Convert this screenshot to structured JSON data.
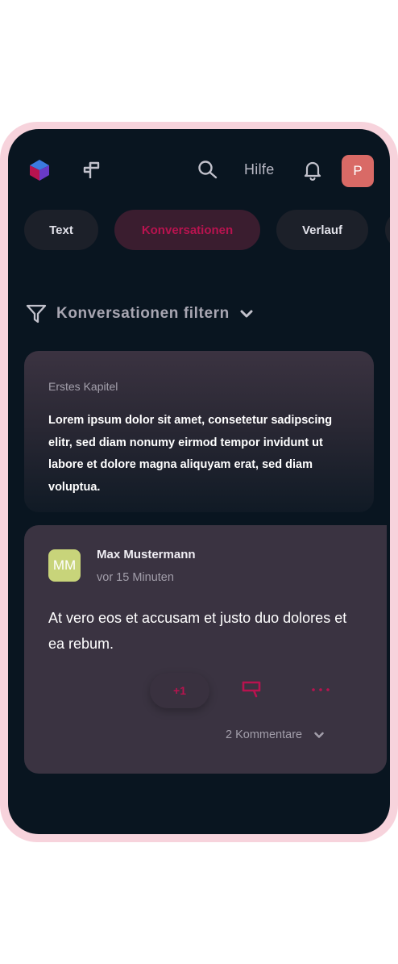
{
  "header": {
    "help_label": "Hilfe",
    "user_initial": "P",
    "icons": [
      "app-logo-icon",
      "signpost-icon",
      "search-icon",
      "bell-icon"
    ]
  },
  "tabs": [
    {
      "label": "Text",
      "active": false
    },
    {
      "label": "Konversationen",
      "active": true
    },
    {
      "label": "Verlauf",
      "active": false
    }
  ],
  "filter": {
    "label": "Konversationen filtern"
  },
  "chapter": {
    "title": "Erstes Kapitel",
    "text": "Lorem ipsum dolor sit amet, consetetur sadipscing elitr, sed diam nonumy eirmod tempor invidunt ut labore et dolore magna aliquyam erat, sed diam voluptua."
  },
  "comment": {
    "author_initials": "MM",
    "author_name": "Max Mustermann",
    "time": "vor 15 Minuten",
    "text": "At vero eos et accusam et justo duo dolores et ea rebum.",
    "upvote_label": "+1",
    "comments_count_label": "2 Kommentare"
  },
  "colors": {
    "background": "#091520",
    "frame": "#f7d3dc",
    "accent": "#b8134f",
    "card": "#3a3341",
    "avatar_user": "#d96a66",
    "avatar_author": "#c8d47a"
  }
}
